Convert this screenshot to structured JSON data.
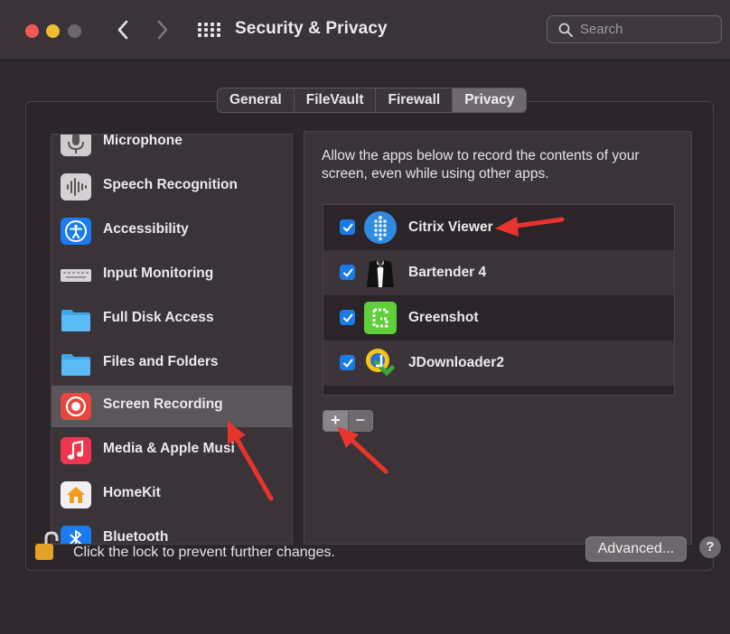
{
  "window": {
    "title": "Security & Privacy",
    "search_placeholder": "Search",
    "icons": [
      "back-icon",
      "forward-icon",
      "show-all-grid-icon",
      "search-icon"
    ]
  },
  "tabs": [
    {
      "label": "General",
      "active": false
    },
    {
      "label": "FileVault",
      "active": false
    },
    {
      "label": "Firewall",
      "active": false
    },
    {
      "label": "Privacy",
      "active": true
    }
  ],
  "sidebar": {
    "items": [
      {
        "label": "Microphone",
        "icon": "microphone-icon",
        "selected": false
      },
      {
        "label": "Speech Recognition",
        "icon": "speech-waveform-icon",
        "selected": false
      },
      {
        "label": "Accessibility",
        "icon": "accessibility-icon",
        "selected": false
      },
      {
        "label": "Input Monitoring",
        "icon": "keyboard-icon",
        "selected": false
      },
      {
        "label": "Full Disk Access",
        "icon": "folder-icon",
        "selected": false
      },
      {
        "label": "Files and Folders",
        "icon": "folder-icon",
        "selected": false
      },
      {
        "label": "Screen Recording",
        "icon": "screen-record-icon",
        "selected": true
      },
      {
        "label": "Media & Apple Musi",
        "icon": "music-note-icon",
        "selected": false
      },
      {
        "label": "HomeKit",
        "icon": "home-icon",
        "selected": false
      },
      {
        "label": "Bluetooth",
        "icon": "bluetooth-icon",
        "selected": false
      }
    ]
  },
  "detail": {
    "description": "Allow the apps below to record the contents of your screen, even while using other apps.",
    "apps": [
      {
        "name": "Citrix Viewer",
        "checked": true,
        "icon": "citrix-viewer-icon"
      },
      {
        "name": "Bartender 4",
        "checked": true,
        "icon": "bartender-tuxedo-icon"
      },
      {
        "name": "Greenshot",
        "checked": true,
        "icon": "greenshot-icon"
      },
      {
        "name": "JDownloader2",
        "checked": true,
        "icon": "jdownloader-icon"
      }
    ],
    "add_label": "+",
    "remove_label": "−"
  },
  "footer": {
    "lock_text": "Click the lock to prevent further changes.",
    "advanced_label": "Advanced...",
    "help_label": "?"
  },
  "colors": {
    "accent_checkbox": "#1b7be6",
    "annotation_arrow": "#e8342c",
    "selected_row": "#5b565a"
  }
}
